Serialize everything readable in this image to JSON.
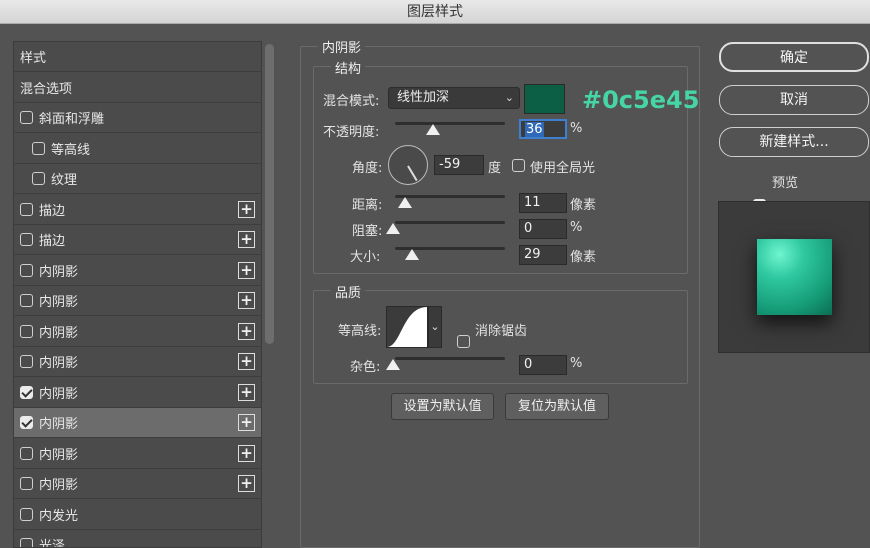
{
  "window": {
    "title": "图层样式"
  },
  "style_list": {
    "items": [
      {
        "label": "样式",
        "checkbox": false,
        "checked": false,
        "plus": false,
        "indent": false,
        "active": false
      },
      {
        "label": "混合选项",
        "checkbox": false,
        "checked": false,
        "plus": false,
        "indent": false,
        "active": false
      },
      {
        "label": "斜面和浮雕",
        "checkbox": true,
        "checked": false,
        "plus": false,
        "indent": false,
        "active": false
      },
      {
        "label": "等高线",
        "checkbox": true,
        "checked": false,
        "plus": false,
        "indent": true,
        "active": false
      },
      {
        "label": "纹理",
        "checkbox": true,
        "checked": false,
        "plus": false,
        "indent": true,
        "active": false
      },
      {
        "label": "描边",
        "checkbox": true,
        "checked": false,
        "plus": true,
        "indent": false,
        "active": false
      },
      {
        "label": "描边",
        "checkbox": true,
        "checked": false,
        "plus": true,
        "indent": false,
        "active": false
      },
      {
        "label": "内阴影",
        "checkbox": true,
        "checked": false,
        "plus": true,
        "indent": false,
        "active": false
      },
      {
        "label": "内阴影",
        "checkbox": true,
        "checked": false,
        "plus": true,
        "indent": false,
        "active": false
      },
      {
        "label": "内阴影",
        "checkbox": true,
        "checked": false,
        "plus": true,
        "indent": false,
        "active": false
      },
      {
        "label": "内阴影",
        "checkbox": true,
        "checked": false,
        "plus": true,
        "indent": false,
        "active": false
      },
      {
        "label": "内阴影",
        "checkbox": true,
        "checked": true,
        "plus": true,
        "indent": false,
        "active": false
      },
      {
        "label": "内阴影",
        "checkbox": true,
        "checked": true,
        "plus": true,
        "indent": false,
        "active": true
      },
      {
        "label": "内阴影",
        "checkbox": true,
        "checked": false,
        "plus": true,
        "indent": false,
        "active": false
      },
      {
        "label": "内阴影",
        "checkbox": true,
        "checked": false,
        "plus": true,
        "indent": false,
        "active": false
      },
      {
        "label": "内发光",
        "checkbox": true,
        "checked": false,
        "plus": false,
        "indent": false,
        "active": false
      },
      {
        "label": "光泽",
        "checkbox": true,
        "checked": false,
        "plus": false,
        "indent": false,
        "active": false
      }
    ],
    "plus_symbol": "+"
  },
  "panel": {
    "title": "内阴影",
    "structure": {
      "title": "结构",
      "blend_mode_label": "混合模式:",
      "blend_mode_value": "线性加深",
      "color_hex_display": "#0c5e45",
      "opacity_label": "不透明度:",
      "opacity_value": "36",
      "opacity_unit": "%",
      "angle_label": "角度:",
      "angle_value": "-59",
      "angle_unit": "度",
      "global_light_label": "使用全局光",
      "global_light_checked": false,
      "distance_label": "距离:",
      "distance_value": "11",
      "distance_unit": "像素",
      "choke_label": "阻塞:",
      "choke_value": "0",
      "choke_unit": "%",
      "size_label": "大小:",
      "size_value": "29",
      "size_unit": "像素"
    },
    "quality": {
      "title": "品质",
      "contour_label": "等高线:",
      "anti_alias_label": "消除锯齿",
      "anti_alias_checked": false,
      "noise_label": "杂色:",
      "noise_value": "0",
      "noise_unit": "%"
    },
    "set_default_label": "设置为默认值",
    "reset_default_label": "复位为默认值"
  },
  "buttons": {
    "ok": "确定",
    "cancel": "取消",
    "new_style": "新建样式...",
    "preview_label": "预览",
    "preview_checked": true
  },
  "colors": {
    "shadow_color": "#0c5e45",
    "hex_text": "#46d6a6",
    "preview_cube": "#2fc8a0"
  }
}
